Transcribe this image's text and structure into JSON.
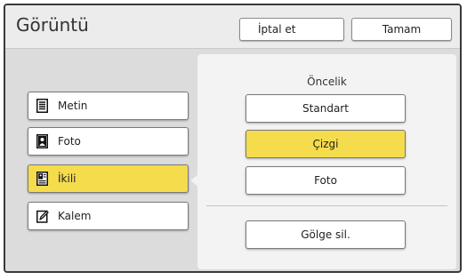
{
  "header": {
    "title": "Görüntü",
    "cancel_label": "İptal et",
    "ok_label": "Tamam"
  },
  "modes": [
    {
      "label": "Metin",
      "icon": "text-document-icon",
      "selected": false
    },
    {
      "label": "Foto",
      "icon": "photo-portrait-icon",
      "selected": false
    },
    {
      "label": "İkili",
      "icon": "text-photo-document-icon",
      "selected": true
    },
    {
      "label": "Kalem",
      "icon": "pencil-icon",
      "selected": false
    }
  ],
  "priority": {
    "label": "Öncelik",
    "options": [
      {
        "label": "Standart",
        "selected": false
      },
      {
        "label": "Çizgi",
        "selected": true
      },
      {
        "label": "Foto",
        "selected": false
      }
    ]
  },
  "shadow_erase_label": "Gölge sil.",
  "colors": {
    "selected": "#f4dc4c",
    "panel": "#f3f3f3",
    "background": "#dcdcdc"
  }
}
